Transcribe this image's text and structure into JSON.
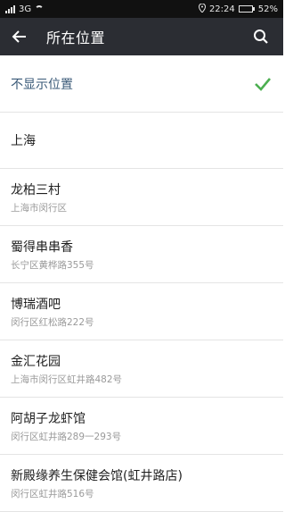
{
  "status_bar": {
    "network": "3G",
    "time": "22:24",
    "battery": "52%",
    "battery_level": 0.52
  },
  "header": {
    "title": "所在位置",
    "back_icon": "arrow-left-icon",
    "search_icon": "search-icon"
  },
  "list": {
    "hide_option": {
      "label": "不显示位置",
      "selected": true
    },
    "city": {
      "name": "上海"
    },
    "items": [
      {
        "name": "龙柏三村",
        "address": "上海市闵行区"
      },
      {
        "name": "蜀得串串香",
        "address": "长宁区黄桦路355号"
      },
      {
        "name": "博瑞酒吧",
        "address": "闵行区红松路222号"
      },
      {
        "name": "金汇花园",
        "address": "上海市闵行区虹井路482号"
      },
      {
        "name": "阿胡子龙虾馆",
        "address": "闵行区虹井路289一293号"
      },
      {
        "name": "新殿缘养生保健会馆(虹井路店)",
        "address": "闵行区虹井路516号"
      }
    ]
  },
  "colors": {
    "app_bar": "#2b2d33",
    "check": "#4caf50"
  }
}
